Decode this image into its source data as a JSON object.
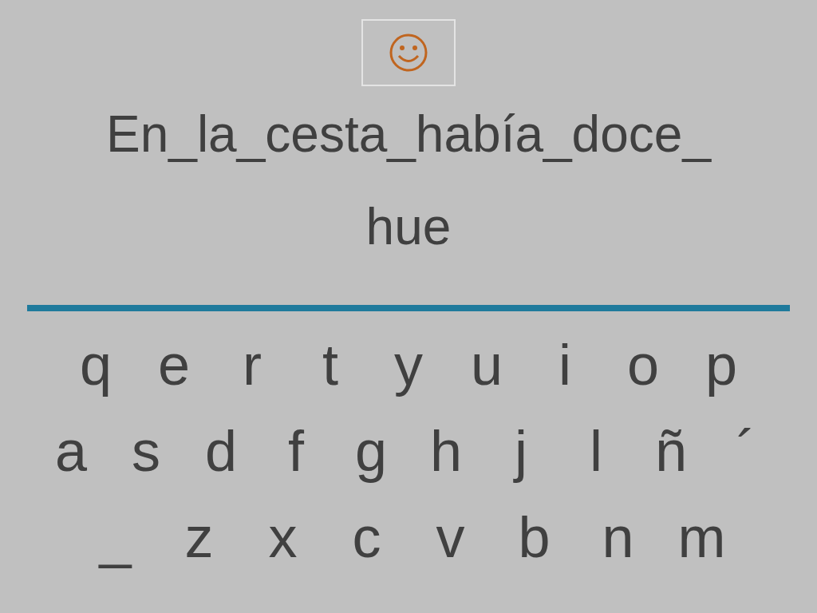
{
  "sentence": "En_la_cesta_había_doce_",
  "answer": "hue",
  "keyboard": {
    "rows": [
      [
        "q",
        "e",
        "r",
        "t",
        "y",
        "u",
        "i",
        "o",
        "p"
      ],
      [
        "a",
        "s",
        "d",
        "f",
        "g",
        "h",
        "j",
        "l",
        "ñ",
        "´"
      ],
      [
        "_",
        "z",
        "x",
        "c",
        "v",
        "b",
        "n",
        "m"
      ]
    ]
  }
}
